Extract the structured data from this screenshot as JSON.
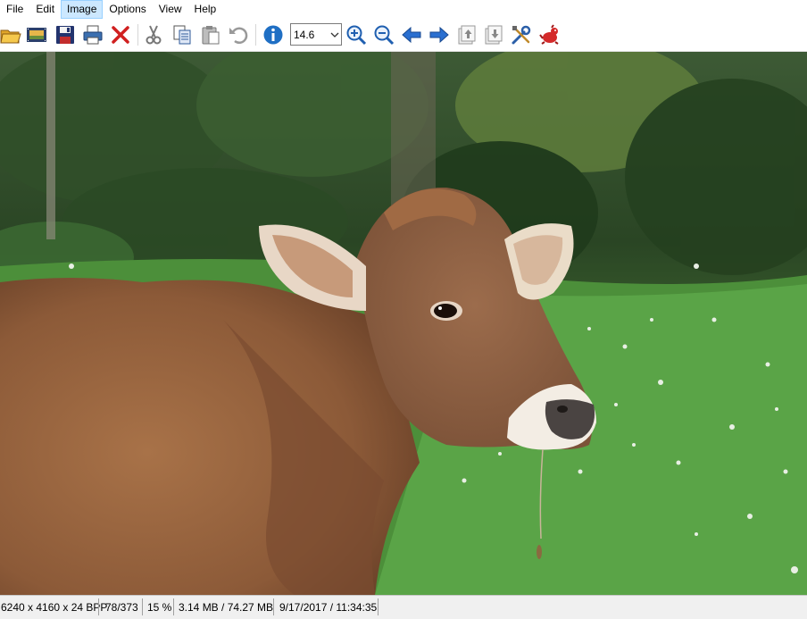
{
  "menu": {
    "items": [
      {
        "label": "File"
      },
      {
        "label": "Edit"
      },
      {
        "label": "Image"
      },
      {
        "label": "Options"
      },
      {
        "label": "View"
      },
      {
        "label": "Help"
      }
    ],
    "active": "Image"
  },
  "toolbar": {
    "zoom_value": "14.6",
    "buttons": [
      "open-folder-icon",
      "slideshow-icon",
      "save-icon",
      "print-icon",
      "delete-icon",
      "cut-icon",
      "copy-icon",
      "paste-icon",
      "undo-icon",
      "info-icon",
      "zoom-in-icon",
      "zoom-out-icon",
      "previous-arrow-icon",
      "next-arrow-icon",
      "page-up-icon",
      "page-down-icon",
      "settings-tools-icon",
      "exit-icon"
    ]
  },
  "status": {
    "dimensions": "6240 x 4160 x 24 BPP",
    "index": "78/373",
    "zoom": "15 %",
    "size": "3.14 MB / 74.27 MB",
    "datetime": "9/17/2017 / 11:34:35"
  },
  "colors": {
    "menu_active_bg": "#cce8ff",
    "grass": "#4f9a3d",
    "forest": "#27401f",
    "cow_body": "#9a6a45",
    "info_blue": "#1f6fc4",
    "delete_red": "#d02020"
  }
}
